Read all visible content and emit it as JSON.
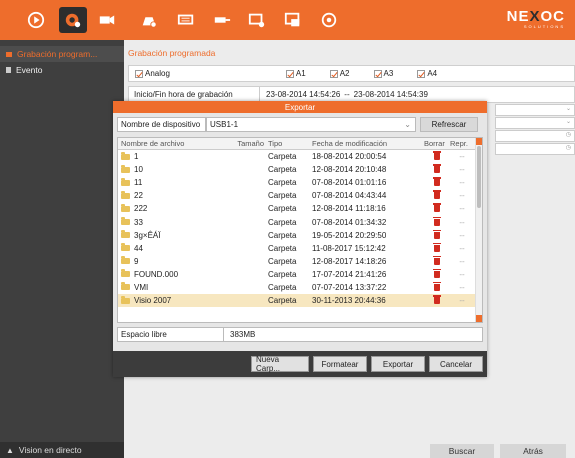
{
  "topbar": {
    "icons": [
      "play-icon",
      "record-settings-icon",
      "camera-settings-icon",
      "alarm-icon",
      "hdd-icon",
      "network-icon",
      "system-settings-icon",
      "maintenance-icon",
      "power-icon"
    ],
    "logo": "NE",
    "logo_mark": "X",
    "logo_tail": "OC",
    "logo_sub": "SOLUTIONS"
  },
  "sidebar": {
    "items": [
      {
        "label": "Grabación program..."
      },
      {
        "label": "Evento"
      }
    ],
    "bottom_label": "Vision en directo"
  },
  "main": {
    "title": "Grabación programada",
    "analog_label": "Analog",
    "channels": [
      "A1",
      "A2",
      "A3",
      "A4"
    ],
    "time_label": "Inicio/Fin hora de grabación",
    "time_start": "23-08-2014 14:54:26",
    "time_sep": "--",
    "time_end": "23-08-2014 14:54:39",
    "search_btn": "Buscar",
    "back_btn": "Atrás"
  },
  "dialog": {
    "title": "Exportar",
    "device_label": "Nombre de dispositivo",
    "device_value": "USB1-1",
    "refresh_btn": "Refrescar",
    "columns": {
      "name": "Nombre de archivo",
      "size": "Tamaño",
      "type": "Tipo",
      "date": "Fecha de modificación",
      "delete": "Borrar",
      "play": "Repr."
    },
    "rows": [
      {
        "name": "1",
        "size": "",
        "type": "Carpeta",
        "date": "18-08-2014 20:00:54",
        "play": "--"
      },
      {
        "name": "10",
        "size": "",
        "type": "Carpeta",
        "date": "12-08-2014 20:10:48",
        "play": "--"
      },
      {
        "name": "11",
        "size": "",
        "type": "Carpeta",
        "date": "07-08-2014 01:01:16",
        "play": "--"
      },
      {
        "name": "22",
        "size": "",
        "type": "Carpeta",
        "date": "07-08-2014 04:43:44",
        "play": "--"
      },
      {
        "name": "222",
        "size": "",
        "type": "Carpeta",
        "date": "12-08-2014 11:18:16",
        "play": "--"
      },
      {
        "name": "33",
        "size": "",
        "type": "Carpeta",
        "date": "07-08-2014 01:34:32",
        "play": "--"
      },
      {
        "name": "3g×ÊÁÏ",
        "size": "",
        "type": "Carpeta",
        "date": "19-05-2014 20:29:50",
        "play": "--"
      },
      {
        "name": "44",
        "size": "",
        "type": "Carpeta",
        "date": "11-08-2017 15:12:42",
        "play": "--"
      },
      {
        "name": "9",
        "size": "",
        "type": "Carpeta",
        "date": "12-08-2017 14:18:26",
        "play": "--"
      },
      {
        "name": "FOUND.000",
        "size": "",
        "type": "Carpeta",
        "date": "17-07-2014 21:41:26",
        "play": "--"
      },
      {
        "name": "VMI",
        "size": "",
        "type": "Carpeta",
        "date": "07-07-2014 13:37:22",
        "play": "--"
      },
      {
        "name": "Visio 2007",
        "size": "",
        "type": "Carpeta",
        "date": "30-11-2013 20:44:36",
        "play": "--"
      }
    ],
    "free_label": "Espacio libre",
    "free_value": "383MB",
    "buttons": {
      "new_folder": "Nueva Carp...",
      "format": "Formatear",
      "export": "Exportar",
      "cancel": "Cancelar"
    }
  },
  "colors": {
    "accent": "#ee6d2c",
    "sidebar_bg": "#3f3f3f",
    "selected_row": "#f7e7c0",
    "delete_icon": "#d12b1f"
  }
}
